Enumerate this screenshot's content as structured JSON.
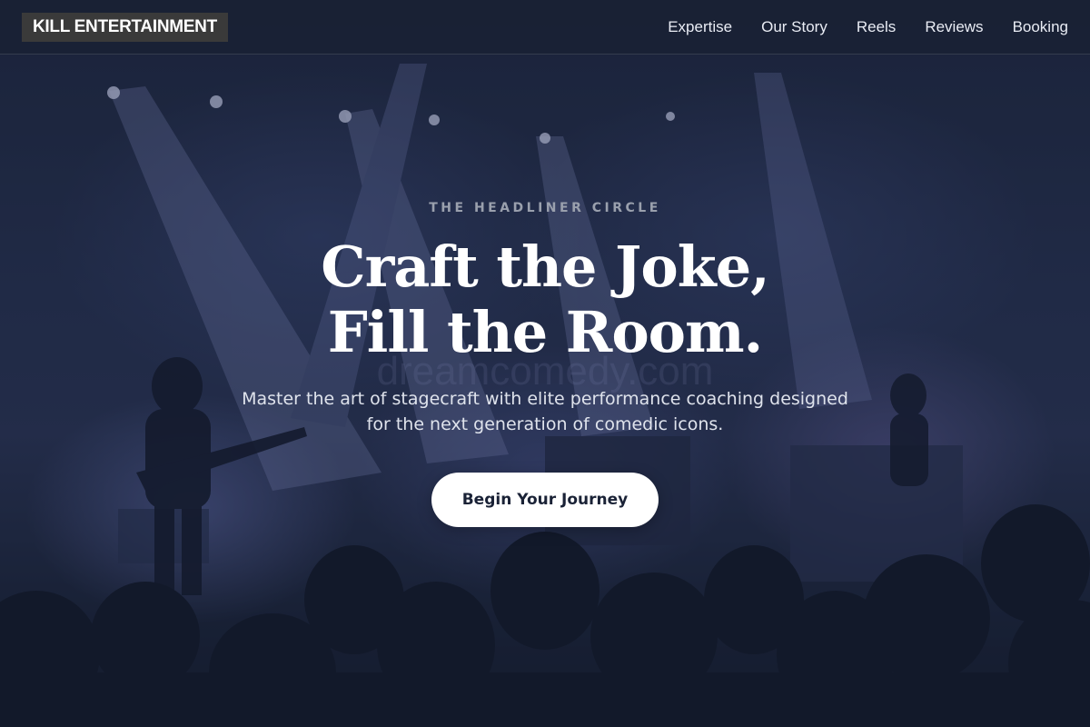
{
  "brand": {
    "name": "KILL ENTERTAINMENT"
  },
  "nav": {
    "items": [
      {
        "label": "Expertise"
      },
      {
        "label": "Our Story"
      },
      {
        "label": "Reels"
      },
      {
        "label": "Reviews"
      },
      {
        "label": "Booking"
      }
    ]
  },
  "hero": {
    "eyebrow": "THE HEADLINER CIRCLE",
    "headline_line1": "Craft the Joke,",
    "headline_line2": "Fill the Room.",
    "subtitle": "Master the art of stagecraft with elite performance coaching designed for the next generation of comedic icons.",
    "cta_label": "Begin Your Journey",
    "watermark": "dreamcomedy.com"
  },
  "colors": {
    "background": "#1a2236",
    "button_bg": "#ffffff",
    "button_text": "#1a2236",
    "brand_bg": "#3a3a3a"
  }
}
